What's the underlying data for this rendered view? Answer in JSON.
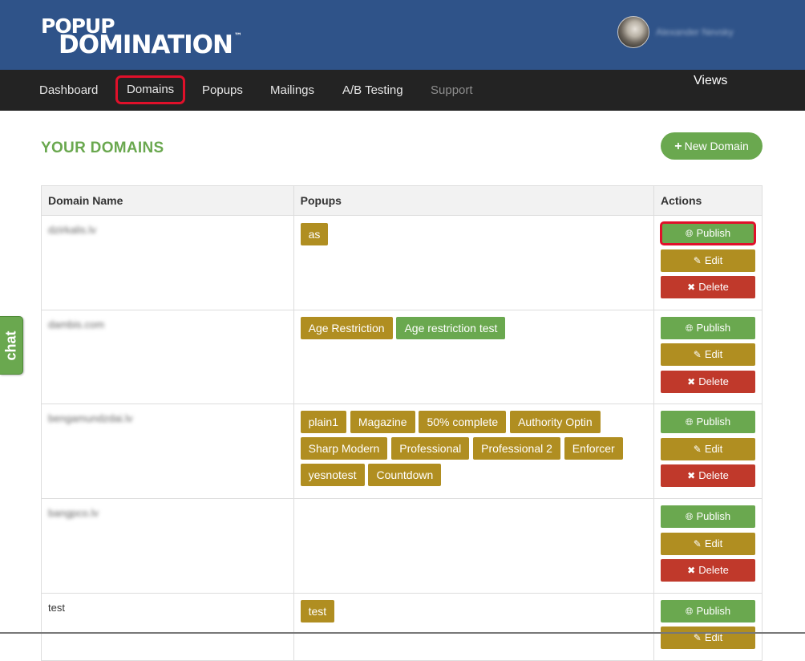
{
  "header": {
    "logo_line1": "POPUP",
    "logo_line2": "DOMINATION",
    "logo_tm": "™",
    "username": "Alexander Nevsky"
  },
  "nav": {
    "items": [
      {
        "label": "Dashboard"
      },
      {
        "label": "Domains"
      },
      {
        "label": "Popups"
      },
      {
        "label": "Mailings"
      },
      {
        "label": "A/B Testing"
      },
      {
        "label": "Support"
      }
    ],
    "views_label": "Views"
  },
  "page": {
    "title": "YOUR DOMAINS",
    "new_domain_label": "New Domain"
  },
  "chat": {
    "label": "chat"
  },
  "table": {
    "headers": [
      "Domain Name",
      "Popups",
      "Actions"
    ],
    "rows": [
      {
        "domain": "dzirkalis.lv",
        "popups": [
          "as"
        ]
      },
      {
        "domain": "dambis.com",
        "popups": [
          "Age Restriction",
          "Age restriction test"
        ]
      },
      {
        "domain": "bengamundzdai.lv",
        "popups": [
          "plain1",
          "Magazine",
          "50% complete",
          "Authority Optin",
          "Sharp Modern",
          "Professional",
          "Professional 2",
          "Enforcer",
          "yesnotest",
          "Countdown"
        ]
      },
      {
        "domain": "bangpco.lv",
        "popups": []
      },
      {
        "domain": "test",
        "popups": [
          "test"
        ]
      }
    ],
    "actions": {
      "publish": "Publish",
      "edit": "Edit",
      "delete": "Delete"
    }
  },
  "colors": {
    "header_bg": "#2f5389",
    "nav_bg": "#232323",
    "accent_green": "#6aa84f",
    "tag_gold": "#b08e21",
    "delete_red": "#c0392b",
    "highlight_red": "#e0102a"
  }
}
